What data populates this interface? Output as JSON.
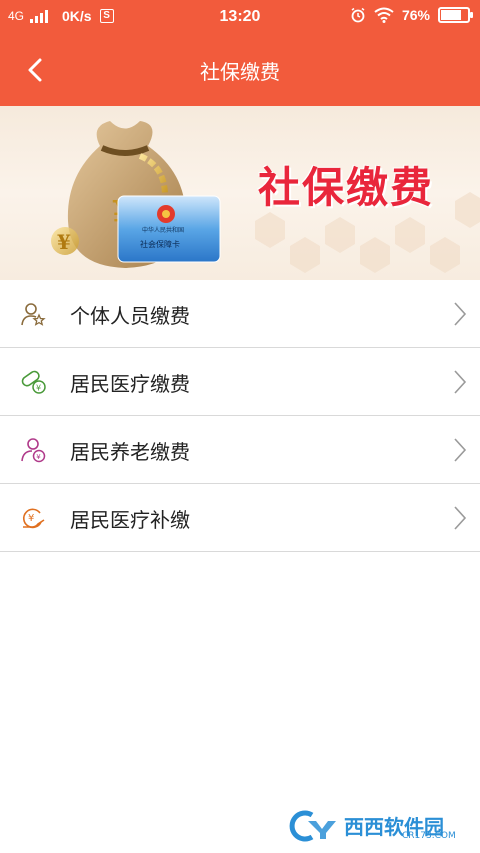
{
  "status_bar": {
    "network": "4G",
    "speed": "0K/s",
    "s_badge": "S",
    "time": "13:20",
    "battery": "76%",
    "battery_level": 0.76
  },
  "nav": {
    "title": "社保缴费",
    "back_icon": "chevron-left-icon"
  },
  "banner": {
    "title": "社保缴费",
    "card_line1": "中华人民共和国",
    "card_line2": "社会保障卡",
    "currency_symbol": "¥"
  },
  "menu": {
    "items": [
      {
        "label": "个体人员缴费",
        "icon": "person-star-icon",
        "icon_color": "#8a6b3c"
      },
      {
        "label": "居民医疗缴费",
        "icon": "pill-icon",
        "icon_color": "#4a9a3a"
      },
      {
        "label": "居民养老缴费",
        "icon": "elderly-icon",
        "icon_color": "#b03a8a"
      },
      {
        "label": "居民医疗补缴",
        "icon": "coin-hand-icon",
        "icon_color": "#e07020"
      }
    ]
  },
  "watermark": {
    "brand": "西西软件园",
    "url": "CR173.COM"
  },
  "colors": {
    "accent": "#f25b3c",
    "banner_title": "#e9263b",
    "divider": "#d9d9d9"
  }
}
